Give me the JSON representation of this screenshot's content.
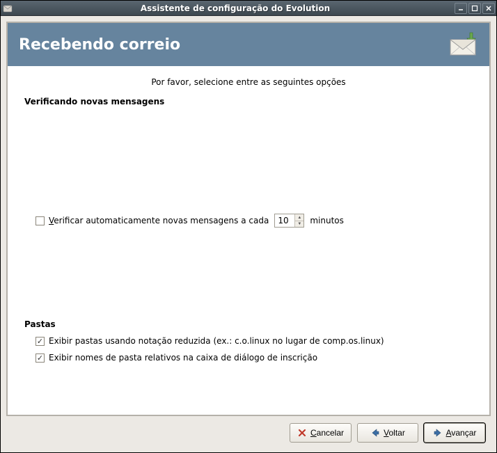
{
  "window": {
    "title": "Assistente de configuração do Evolution"
  },
  "header": {
    "title": "Recebendo correio"
  },
  "instruction": "Por favor, selecione entre as seguintes opções",
  "sections": {
    "checking": {
      "header": "Verificando novas mensagens",
      "auto_check": {
        "checked": false,
        "label_prefix_u": "V",
        "label_prefix_rest": "erificar automaticamente novas mensagens a cada",
        "value": "10",
        "unit": "minutos"
      }
    },
    "folders": {
      "header": "Pastas",
      "short_notation": {
        "checked": true,
        "label": "Exibir pastas usando notação reduzida (ex.: c.o.linux no lugar de comp.os.linux)"
      },
      "relative_names": {
        "checked": true,
        "label": "Exibir nomes de pasta relativos na caixa de diálogo de inscrição"
      }
    }
  },
  "buttons": {
    "cancel": {
      "u": "C",
      "rest": "ancelar"
    },
    "back": {
      "u": "V",
      "rest": "oltar"
    },
    "forward": {
      "u": "A",
      "rest": "vançar"
    }
  }
}
